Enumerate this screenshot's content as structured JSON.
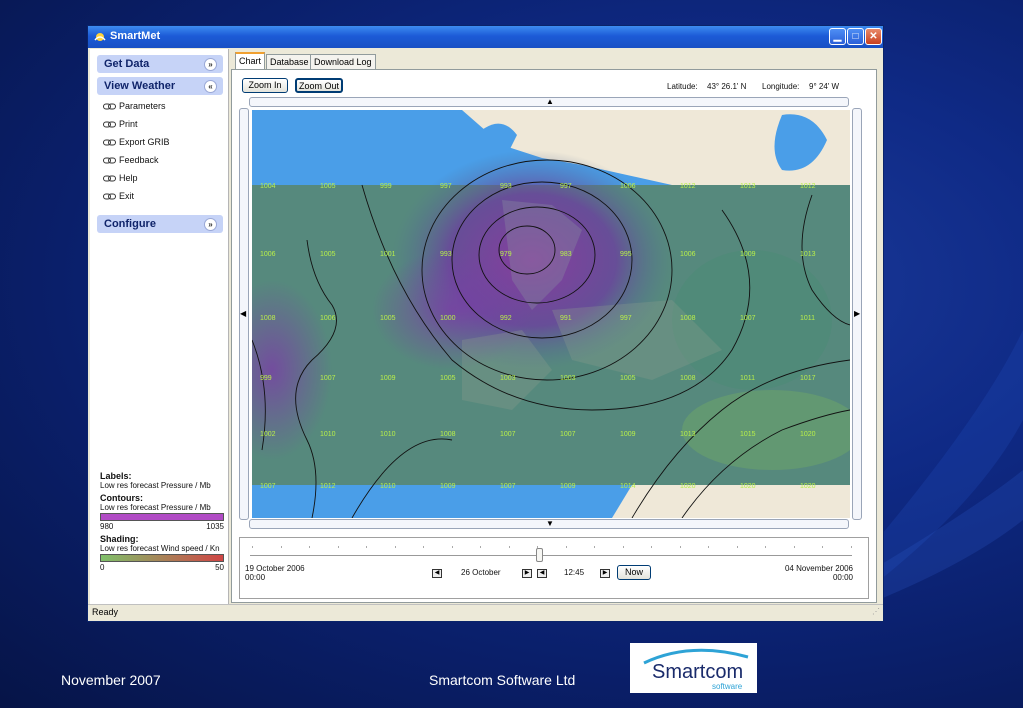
{
  "window": {
    "title": "SmartMet",
    "status": "Ready"
  },
  "sidebar": {
    "sections": [
      {
        "label": "Get Data",
        "chevron": "double-chevron-down-icon"
      },
      {
        "label": "View Weather",
        "chevron": "double-chevron-up-icon"
      },
      {
        "label": "Configure",
        "chevron": "double-chevron-down-icon"
      }
    ],
    "items": [
      {
        "label": "Parameters",
        "icon": "link-icon"
      },
      {
        "label": "Print",
        "icon": "link-icon"
      },
      {
        "label": "Export GRIB",
        "icon": "link-icon"
      },
      {
        "label": "Feedback",
        "icon": "link-icon"
      },
      {
        "label": "Help",
        "icon": "link-icon"
      },
      {
        "label": "Exit",
        "icon": "link-icon"
      }
    ],
    "legend": {
      "labels_heading": "Labels:",
      "labels_value": "Low res forecast Pressure / Mb",
      "contours_heading": "Contours:",
      "contours_value": "Low res forecast Pressure / Mb",
      "contours_min": "980",
      "contours_max": "1035",
      "shading_heading": "Shading:",
      "shading_value": "Low res forecast Wind speed / Kn",
      "shading_min": "0",
      "shading_max": "50"
    }
  },
  "tabs": [
    {
      "label": "Chart"
    },
    {
      "label": "Database"
    },
    {
      "label": "Download Log"
    }
  ],
  "toolbar": {
    "zoom_in": "Zoom In",
    "zoom_out": "Zoom Out",
    "latitude_label": "Latitude:",
    "latitude_value": "43° 26.1' N",
    "longitude_label": "Longitude:",
    "longitude_value": "9° 24' W"
  },
  "map": {
    "pressure_labels": [
      [
        "1004",
        "1005",
        "999",
        "997",
        "993",
        "997",
        "1006",
        "1012",
        "1013",
        "1012"
      ],
      [
        "1006",
        "1005",
        "1001",
        "993",
        "979",
        "983",
        "995",
        "1006",
        "1009",
        "1013"
      ],
      [
        "1008",
        "1006",
        "1005",
        "1000",
        "992",
        "991",
        "997",
        "1008",
        "1007",
        "1011"
      ],
      [
        "999",
        "1007",
        "1009",
        "1005",
        "1003",
        "1003",
        "1005",
        "1008",
        "1011",
        "1017"
      ],
      [
        "1002",
        "1010",
        "1010",
        "1008",
        "1007",
        "1007",
        "1009",
        "1013",
        "1015",
        "1020"
      ],
      [
        "1007",
        "1012",
        "1010",
        "1009",
        "1007",
        "1009",
        "1014",
        "1020",
        "1020",
        "1020"
      ]
    ]
  },
  "timeline": {
    "start_date": "19 October 2006",
    "start_time": "00:00",
    "current_date": "26 October",
    "current_time": "12:45",
    "now_button": "Now",
    "end_date": "04 November 2006",
    "end_time": "00:00",
    "slider_position": 0.48
  },
  "footer": {
    "date": "November 2007",
    "company": "Smartcom Software Ltd",
    "logo_main": "Smartcom",
    "logo_sub": "software"
  },
  "colors": {
    "titlebar": "#1c5bd7",
    "sidebar_header": "#c6d3f7",
    "slide_bg": "#0f2a86",
    "sea": "#4a9ee8",
    "land": "#efe8d8"
  }
}
